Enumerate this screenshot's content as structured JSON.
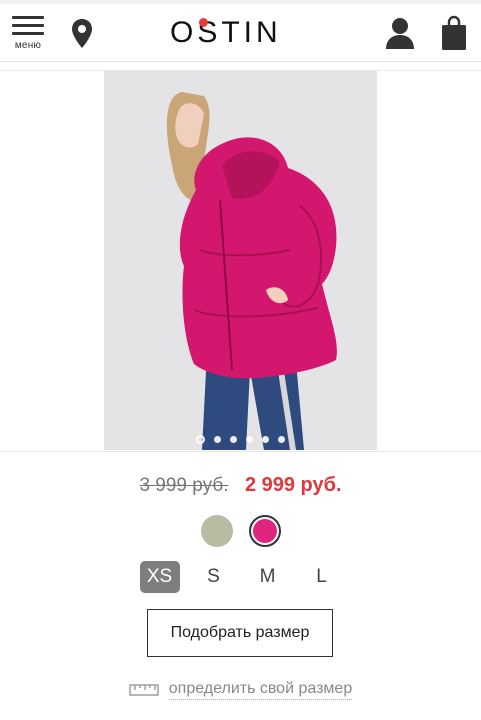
{
  "header": {
    "menu_label": "меню",
    "logo_text": "OSTIN",
    "icons": {
      "menu": "hamburger-icon",
      "location": "location-pin-icon",
      "user": "user-icon",
      "cart": "shopping-bag-icon"
    }
  },
  "gallery": {
    "image": "model-in-pink-puffer-jacket",
    "dots": 6,
    "active_dot": 1
  },
  "product": {
    "old_price": "3 999 руб.",
    "new_price": "2 999 руб.",
    "colors": [
      {
        "name": "sage",
        "hex": "#b9bca3",
        "selected": false
      },
      {
        "name": "fuchsia",
        "hex": "#e0247f",
        "selected": true
      }
    ],
    "sizes": [
      {
        "label": "XS",
        "selected": true
      },
      {
        "label": "S",
        "selected": false
      },
      {
        "label": "M",
        "selected": false
      },
      {
        "label": "L",
        "selected": false
      }
    ],
    "fit_button": "Подобрать размер",
    "size_link": "определить свой размер"
  },
  "colors": {
    "accent_price": "#e0383b",
    "logo_dot": "#e63a3a",
    "selected_size_bg": "#7e7e7e"
  }
}
